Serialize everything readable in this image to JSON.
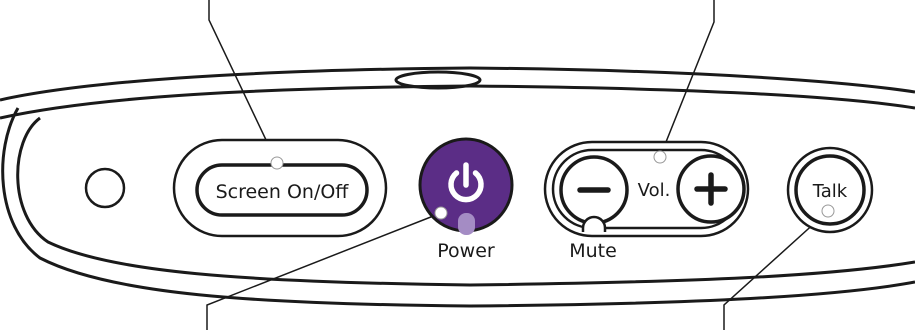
{
  "buttons": {
    "screen": "Screen On/Off",
    "volume": "Vol.",
    "talk": "Talk"
  },
  "labels": {
    "power": "Power",
    "mute": "Mute"
  },
  "colors": {
    "power_button": "#5b2d86",
    "outline": "#1a1a1a",
    "callout_dot": "#ffffff"
  }
}
